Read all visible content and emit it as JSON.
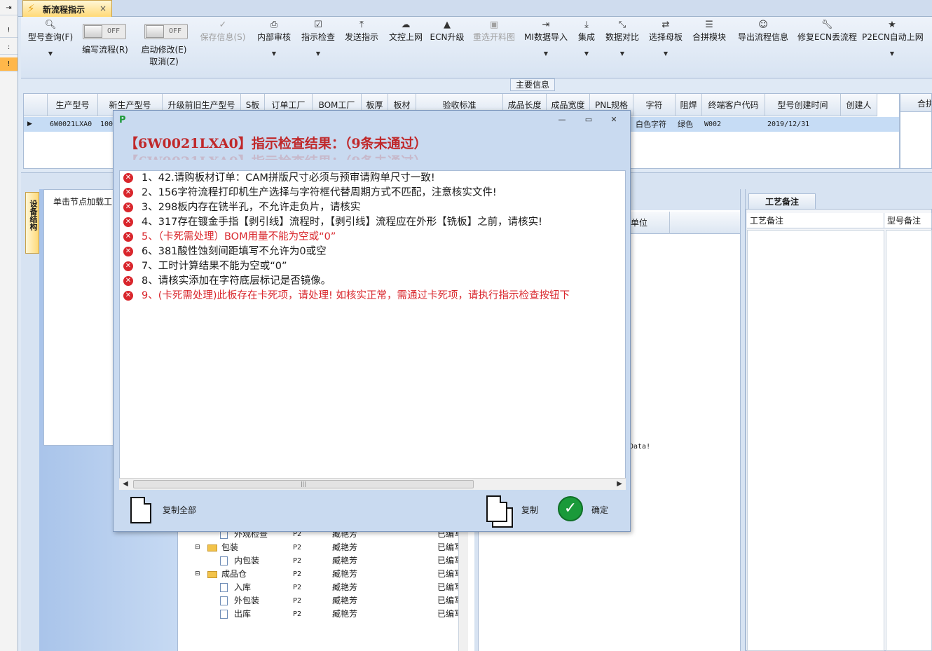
{
  "tab": {
    "title": "新流程指示",
    "close": "×"
  },
  "left_strip": [
    "!",
    ":",
    "!"
  ],
  "ribbon": {
    "model_query": "型号查询(F)",
    "edit_flow": "编写流程(R)",
    "edit_toggle": "OFF",
    "start_modify_line1": "启动修改(E)",
    "start_modify_line2": "取消(Z)",
    "start_toggle": "OFF",
    "buttons": [
      {
        "label": "保存信息(S)",
        "icon": "save-icon"
      },
      {
        "label": "内部审核",
        "icon": "printer-icon"
      },
      {
        "label": "指示检查",
        "icon": "check-icon"
      },
      {
        "label": "发送指示",
        "icon": "upload-icon"
      },
      {
        "label": "文控上网",
        "icon": "cloud-upload-icon"
      },
      {
        "label": "ECN升级",
        "icon": "ecn-icon"
      },
      {
        "label": "重选开料图",
        "icon": "image-icon"
      },
      {
        "label": "MI数据导入",
        "icon": "import-icon"
      },
      {
        "label": "集成",
        "icon": "download-icon"
      },
      {
        "label": "数据对比",
        "icon": "compare-icon"
      },
      {
        "label": "选择母板",
        "icon": "shuffle-icon"
      },
      {
        "label": "合拼模块",
        "icon": "list-icon"
      },
      {
        "label": "导出流程信息",
        "icon": "smile-icon"
      },
      {
        "label": "修复ECN丢流程",
        "icon": "wrench-icon"
      },
      {
        "label": "P2ECN自动上网",
        "icon": "star-icon"
      }
    ]
  },
  "main_info": {
    "label": "主要信息",
    "columns": [
      "生产型号",
      "新生产型号",
      "升级前旧生产型号",
      "S板",
      "订单工厂",
      "BOM工厂",
      "板厚",
      "板材",
      "验收标准",
      "成品长度",
      "成品宽度",
      "PNL规格",
      "字符",
      "阻焊",
      "终端客户代码",
      "型号创建时间",
      "创建人"
    ],
    "right_header": "合拼",
    "row": {
      "production_model": "6W0021LXA0",
      "new_model": "1001",
      "char": "白色字符",
      "solder": "绿色",
      "customer_code": "W002",
      "created": "2019/12/31"
    }
  },
  "lower": {
    "vtab": "设备结构",
    "left_head": "单击节点加载工",
    "unit_header": "单位",
    "no_data": "Data!",
    "craft_tab": "工艺备注",
    "craft_col1": "工艺备注",
    "craft_col2": "型号备注",
    "tree": [
      {
        "name": "外观检查",
        "type": "file",
        "code": "P2",
        "owner": "臧艳芳",
        "status": "已编写"
      },
      {
        "name": "包装",
        "type": "folder",
        "code": "P2",
        "owner": "臧艳芳",
        "status": "已编写"
      },
      {
        "name": "内包装",
        "type": "file",
        "code": "P2",
        "owner": "臧艳芳",
        "status": "已编写"
      },
      {
        "name": "成品仓",
        "type": "folder",
        "code": "P2",
        "owner": "臧艳芳",
        "status": "已编写"
      },
      {
        "name": "入库",
        "type": "file",
        "code": "P2",
        "owner": "臧艳芳",
        "status": "已编写"
      },
      {
        "name": "外包装",
        "type": "file",
        "code": "P2",
        "owner": "臧艳芳",
        "status": "已编写"
      },
      {
        "name": "出库",
        "type": "file",
        "code": "P2",
        "owner": "臧艳芳",
        "status": "已编写"
      }
    ]
  },
  "dialog": {
    "heading": "【6W0021LXA0】指示检查结果：（9条未通过）",
    "messages": [
      {
        "text": "1、42.请购板材订单：CAM拼版尺寸必须与预审请购单尺寸一致!",
        "red": false
      },
      {
        "text": "2、156字符流程打印机生产选择与字符框代替周期方式不匹配，注意核实文件!",
        "red": false
      },
      {
        "text": "3、298板内存在铣半孔，不允许走负片，请核实",
        "red": false
      },
      {
        "text": "4、317存在镀金手指【剥引线】流程时，【剥引线】流程应在外形【铣板】之前，请核实!",
        "red": false
      },
      {
        "text": "5、（卡死需处理）BOM用量不能为空或“0”",
        "red": true
      },
      {
        "text": "6、381酸性蚀刻间距填写不允许为0或空",
        "red": false
      },
      {
        "text": "7、工时计算结果不能为空或“0”",
        "red": false
      },
      {
        "text": "8、请核实添加在字符底层标记是否镜像。",
        "red": false
      },
      {
        "text": "9、(卡死需处理)此板存在卡死项，请处理! 如核实正常，需通过卡死项，请执行指示检查按钮下",
        "red": true
      }
    ],
    "copy_all": "复制全部",
    "copy": "复制",
    "ok": "确定"
  },
  "colors": {
    "error_red": "#d9262c",
    "ok_green": "#1a9a3a",
    "selected_row": "#c6dcf5"
  }
}
